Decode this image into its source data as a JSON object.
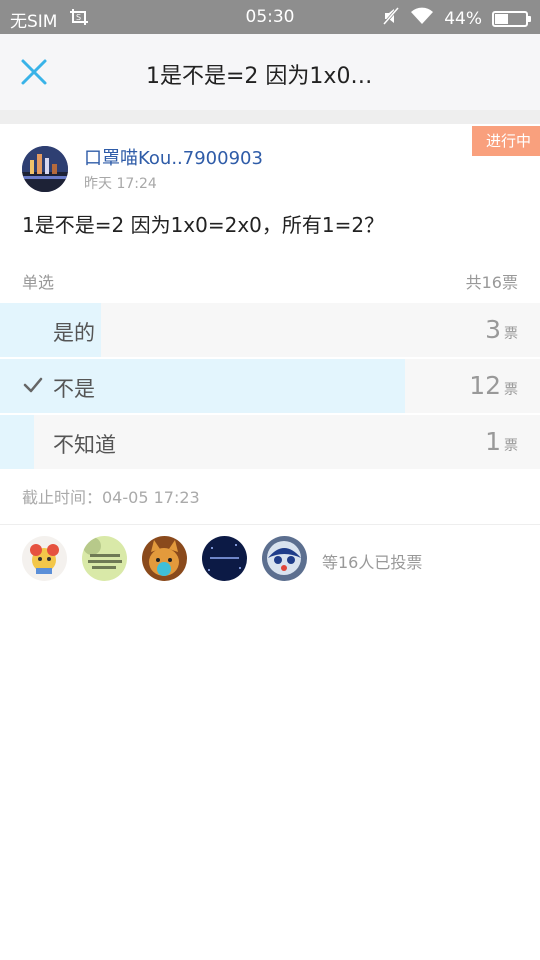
{
  "status_bar": {
    "carrier": "无SIM",
    "time": "05:30",
    "battery": "44%",
    "battery_level": 0.44
  },
  "header": {
    "title": "1是不是=2 因为1x0…"
  },
  "post": {
    "status": "进行中",
    "author": "口罩喵Kou..7900903",
    "time": "昨天 17:24",
    "text": "1是不是=2 因为1x0=2x0，所有1=2？"
  },
  "poll": {
    "type": "单选",
    "total": "共16票",
    "unit": "票",
    "options": [
      {
        "label": "是的",
        "count": "3",
        "fraction": 0.1875,
        "selected": false
      },
      {
        "label": "不是",
        "count": "12",
        "fraction": 0.75,
        "selected": true
      },
      {
        "label": "不知道",
        "count": "1",
        "fraction": 0.0625,
        "selected": false
      }
    ],
    "deadline": "截止时间：04-05 17:23"
  },
  "voters": {
    "summary": "等16人已投票"
  },
  "colors": {
    "accent": "#39b3e8",
    "bar": "#e3f5fd",
    "status_tag": "#f9a07d",
    "author": "#2f5ca8"
  }
}
